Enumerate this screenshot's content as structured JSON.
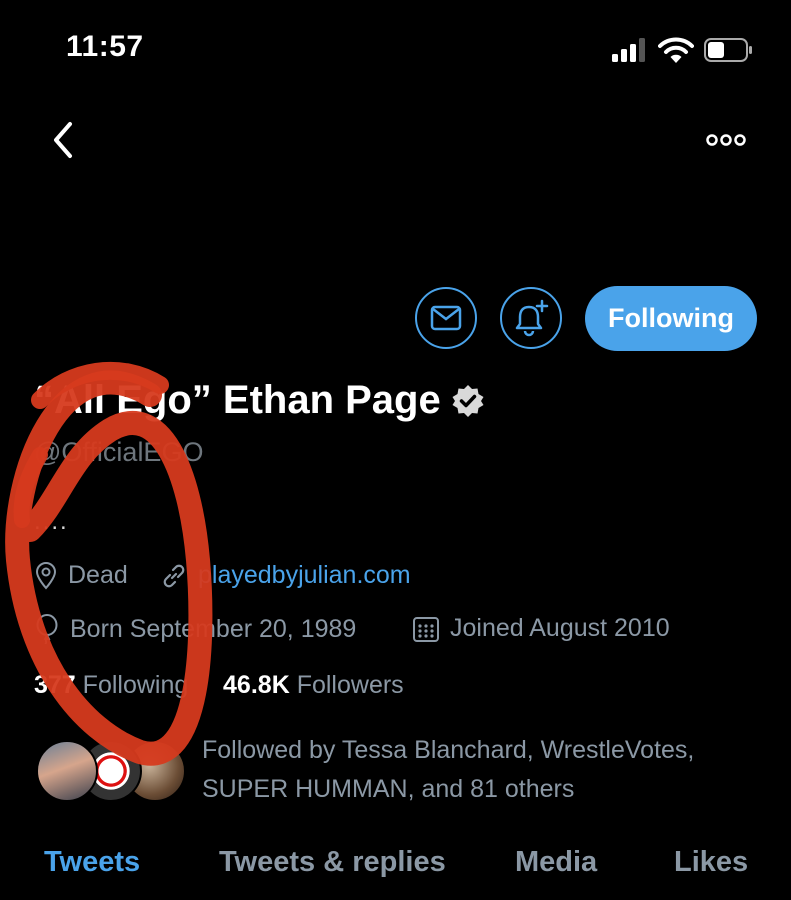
{
  "status_bar": {
    "time": "11:57"
  },
  "header": {
    "back_icon": "chevron-left-icon",
    "more_icon": "ellipsis-icon"
  },
  "actions": {
    "message_icon": "mail-icon",
    "notify_icon": "bell-plus-icon",
    "following_label": "Following",
    "accent_color": "#4aa3ea"
  },
  "profile": {
    "display_name": "“All Ego” Ethan Page",
    "handle": "@OfficialEGO",
    "bio": "....",
    "location": "Dead",
    "website": "playedbyjulian.com",
    "birthday": "Born September 20, 1989",
    "joined": "Joined August 2010",
    "following_count": "377",
    "following_label": "Following",
    "followers_count": "46.8K",
    "followers_label": "Followers",
    "followed_by": "Followed by Tessa Blanchard, WrestleVotes, SUPER HUMMAN, and 81 others"
  },
  "tabs": [
    {
      "label": "Tweets",
      "active": true
    },
    {
      "label": "Tweets & replies",
      "active": false
    },
    {
      "label": "Media",
      "active": false
    },
    {
      "label": "Likes",
      "active": false
    }
  ],
  "annotation": {
    "color": "#d63a1e",
    "shape": "hand-drawn red circle"
  }
}
